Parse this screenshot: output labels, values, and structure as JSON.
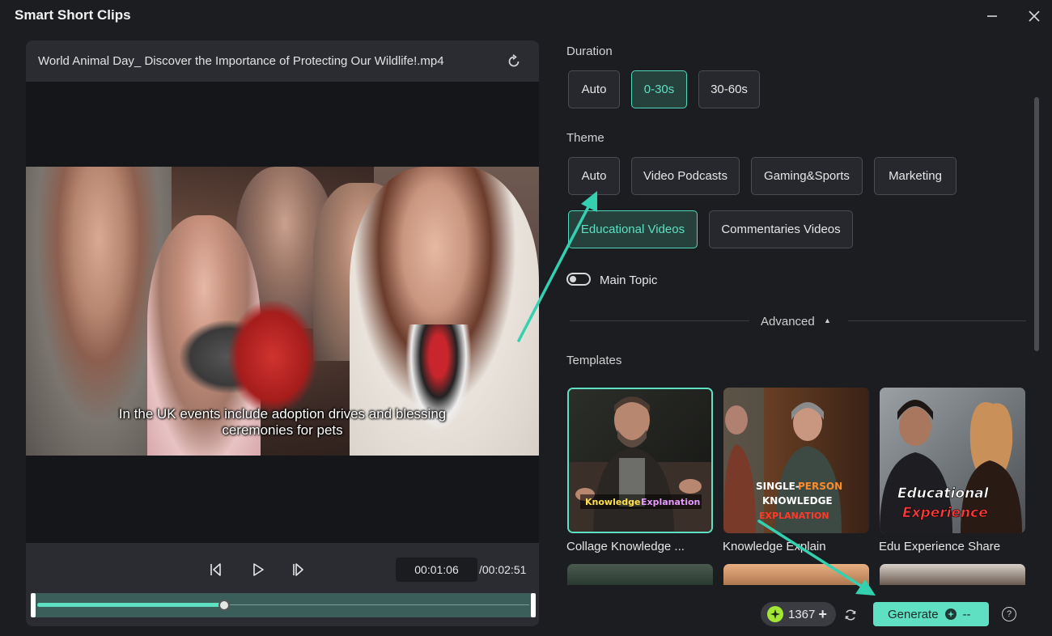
{
  "window": {
    "title": "Smart Short Clips"
  },
  "preview": {
    "file_name": "World Animal Day_ Discover the Importance of Protecting Our Wildlife!.mp4",
    "subtitle_line1": "In the UK  events include adoption drives and blessing",
    "subtitle_line2": "ceremonies for pets",
    "current_time": "00:01:06",
    "total_time": "/00:02:51",
    "progress": 0.38
  },
  "settings": {
    "duration_label": "Duration",
    "duration_options": [
      {
        "label": "Auto",
        "active": false
      },
      {
        "label": "0-30s",
        "active": true
      },
      {
        "label": "30-60s",
        "active": false
      }
    ],
    "theme_label": "Theme",
    "theme_options": [
      {
        "label": "Auto",
        "active": false
      },
      {
        "label": "Video Podcasts",
        "active": false
      },
      {
        "label": "Gaming&Sports",
        "active": false
      },
      {
        "label": "Marketing",
        "active": false
      },
      {
        "label": "Educational Videos",
        "active": true
      },
      {
        "label": "Commentaries Videos",
        "active": false
      }
    ],
    "main_topic_label": "Main Topic",
    "main_topic_enabled": false,
    "advanced_label": "Advanced",
    "templates_label": "Templates",
    "templates": [
      {
        "name": "Collage Knowledge ...",
        "overlay_text": [
          "Knowledge",
          "Explanation"
        ],
        "active": true
      },
      {
        "name": "Knowledge Explain",
        "overlay_text": [
          "SINGLE-",
          "PERSON",
          "KNOWLEDGE",
          "EXPLANATION"
        ],
        "active": false
      },
      {
        "name": "Edu Experience Share",
        "overlay_text": [
          "Educational",
          "Experience"
        ],
        "active": false
      }
    ]
  },
  "footer": {
    "credits": "1367",
    "generate_label": "Generate",
    "generate_suffix": "--",
    "help_label": "?"
  },
  "colors": {
    "accent": "#5fe0c3",
    "background": "#1c1d21",
    "panel": "#2a2c31"
  }
}
